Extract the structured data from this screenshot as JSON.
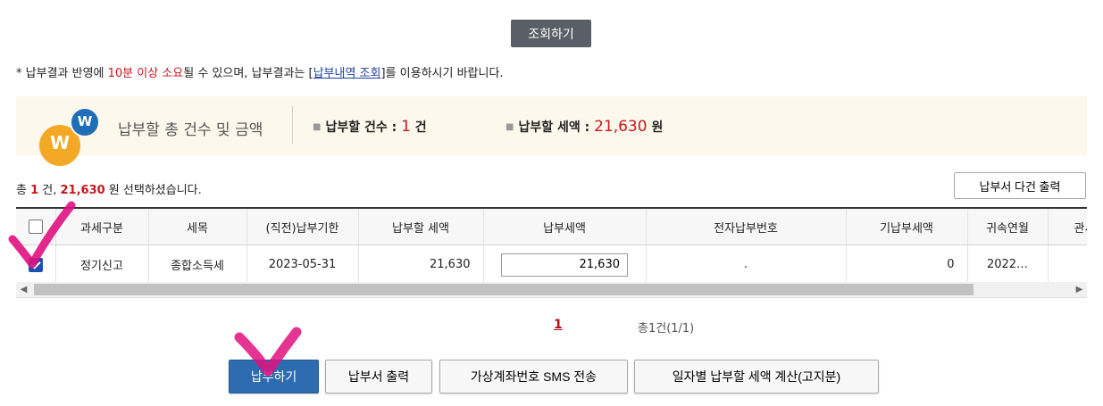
{
  "search_button": "조회하기",
  "notice": {
    "prefix": "* 납부결과 반영에 ",
    "highlight": "10분 이상 소요",
    "middle": "될 수 있으며, 납부결과는 [",
    "link": "납부내역 조회",
    "suffix": "]를 이용하시기 바랍니다."
  },
  "summary": {
    "logo_text_main": "W",
    "logo_text_badge": "W",
    "title": "납부할 총 건수 및 금액",
    "count_label": "납부할 건수 :",
    "count_value": "1",
    "count_unit": "건",
    "amount_label": "납부할 세액 :",
    "amount_value": "21,630",
    "amount_unit": "원"
  },
  "selection": {
    "prefix": "총 ",
    "count": "1",
    "mid": " 건, ",
    "amount": "21,630",
    "suffix": " 원 선택하셨습니다."
  },
  "multi_print_button": "납부서 다건 출력",
  "table": {
    "headers": [
      "과세구분",
      "세목",
      "(직전)납부기한",
      "납부할 세액",
      "납부세액",
      "전자납부번호",
      "기납부세액",
      "귀속연월",
      "관서명"
    ],
    "row": {
      "checked": true,
      "cells": [
        "정기신고",
        "종합소득세",
        "2023-05-31",
        "21,630",
        "21,630",
        ".",
        "0",
        "2022…",
        "."
      ]
    }
  },
  "pager": {
    "current": "1",
    "total": "총1건(1/1)"
  },
  "buttons": {
    "pay": "납부하기",
    "print": "납부서 출력",
    "sms": "가상계좌번호 SMS 전송",
    "daily": "일자별 납부할 세액 계산(고지분)"
  },
  "colors": {
    "accent_red": "#c8161d",
    "primary_blue": "#2d6cb0",
    "annotation_magenta": "#e0107f"
  }
}
